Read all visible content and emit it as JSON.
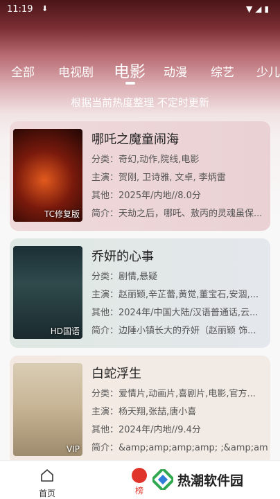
{
  "statusbar": {
    "time": "11:19"
  },
  "tabs": [
    {
      "label": "全部"
    },
    {
      "label": "电视剧"
    },
    {
      "label": "电影"
    },
    {
      "label": "动漫"
    },
    {
      "label": "综艺"
    },
    {
      "label": "少儿"
    }
  ],
  "subtitle": "根据当前热度整理 不定时更新",
  "movies": [
    {
      "title": "哪吒之魔童闹海",
      "genre": "分类：奇幻,动作,院线,电影",
      "cast": "主演：贺刚, 卫诗雅, 文卓, 李炳雷",
      "other": "其他：2025年/内地//8.0分",
      "intro": "简介：天劫之后，哪吒、敖丙的灵魂虽保...",
      "badge": "TC修复版"
    },
    {
      "title": "乔妍的心事",
      "genre": "分类：剧情,悬疑",
      "cast": "主演：赵丽颖,辛芷蕾,黄觉,董宝石,安涸,...",
      "other": "其他：2024年/中国大陆/汉语普通话,云...",
      "intro": "简介：边陲小镇长大的乔妍（赵丽颖 饰...",
      "badge": "HD国语"
    },
    {
      "title": "白蛇浮生",
      "genre": "分类：爱情片,动画片,喜剧片,电影,官方...",
      "cast": "主演：杨天翔,张喆,唐小喜",
      "other": "其他：2024年/内地//9.4分",
      "intro": "简介：&amp;amp;amp;amp;  ;&amp;amp;amp;amp;",
      "badge": "VIP"
    }
  ],
  "bottom_nav": {
    "home_label": "首页",
    "rank_label": "榜"
  },
  "watermark": {
    "text": "热潮软件园"
  }
}
